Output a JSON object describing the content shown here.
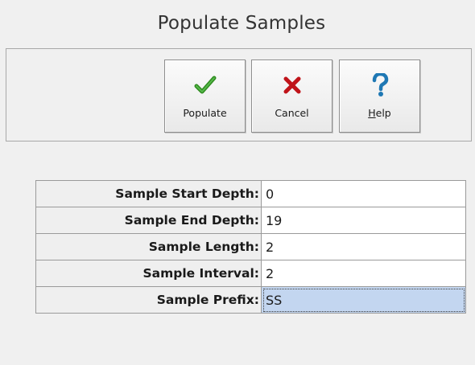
{
  "window": {
    "title": "Populate Samples"
  },
  "toolbar": {
    "buttons": [
      {
        "label": "Populate",
        "icon": "checkmark-icon",
        "color": "#2e8b1f"
      },
      {
        "label": "Cancel",
        "icon": "x-icon",
        "color": "#c0141a"
      },
      {
        "label_first": "H",
        "label_rest": "elp",
        "icon": "question-mark-icon",
        "color": "#1f78b4"
      }
    ]
  },
  "form": {
    "rows": [
      {
        "label": "Sample Start Depth:",
        "value": "0"
      },
      {
        "label": "Sample End Depth:",
        "value": "19"
      },
      {
        "label": "Sample Length:",
        "value": "2"
      },
      {
        "label": "Sample Interval:",
        "value": "2"
      },
      {
        "label": "Sample Prefix:",
        "value": "SS",
        "selected": true
      }
    ]
  },
  "colors": {
    "selected_cell": "#c3d6f0"
  }
}
